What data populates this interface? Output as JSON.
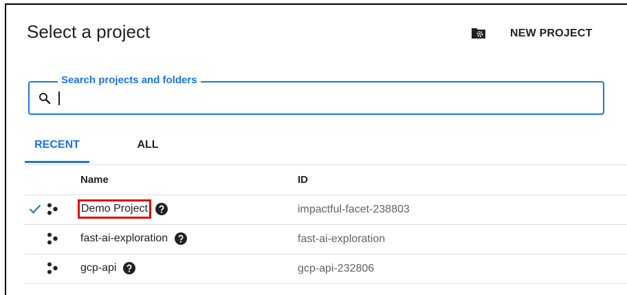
{
  "dialog": {
    "title": "Select a project",
    "new_project_label": "NEW PROJECT"
  },
  "search": {
    "label": "Search projects and folders",
    "value": ""
  },
  "tabs": [
    {
      "label": "RECENT",
      "active": true
    },
    {
      "label": "ALL",
      "active": false
    }
  ],
  "table": {
    "headers": {
      "name": "Name",
      "id": "ID"
    },
    "rows": [
      {
        "name": "Demo Project",
        "id": "impactful-facet-238803",
        "selected": true
      },
      {
        "name": "fast-ai-exploration",
        "id": "fast-ai-exploration",
        "selected": false
      },
      {
        "name": "gcp-api",
        "id": "gcp-api-232806",
        "selected": false
      }
    ]
  },
  "colors": {
    "accent": "#1a73e8",
    "highlight": "#e00000",
    "secondary_text": "#5f6368"
  }
}
